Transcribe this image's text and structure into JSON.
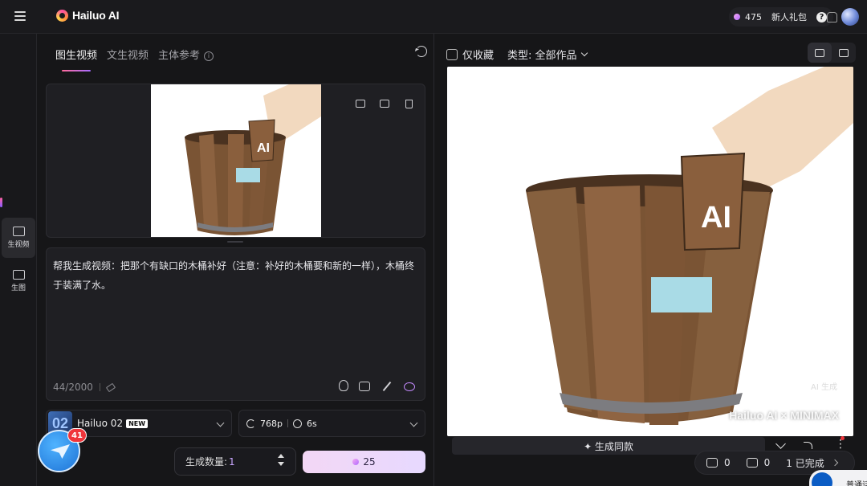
{
  "header": {
    "logo_text": "Hailuo AI",
    "credits": "475",
    "gift_label": "新人礼包",
    "help_label": "?"
  },
  "rail": {
    "items": [
      {
        "label": "生视频",
        "active": true
      },
      {
        "label": "生图",
        "active": false
      }
    ]
  },
  "left": {
    "tabs": [
      {
        "label": "图生视频",
        "active": true
      },
      {
        "label": "文生视频",
        "active": false
      },
      {
        "label": "主体参考",
        "active": false
      }
    ],
    "prompt": "帮我生成视频：把那个有缺口的木桶补好（注意：补好的木桶要和新的一样），木桶终于装满了水。",
    "char_count": "44/2000",
    "model": {
      "logo": "02",
      "name": "Hailuo 02",
      "badge": "NEW"
    },
    "resolution": "768p",
    "duration": "6s",
    "quantity_label": "生成数量:",
    "quantity_value": "1",
    "generate_cost": "25"
  },
  "right": {
    "favorites_label": "仅收藏",
    "type_filter": "类型: 全部作品",
    "ai_generated_mark": "AI 生成",
    "watermark": "Hailuo AI × MINIMAX",
    "same_style_label": "✦ 生成同款",
    "stats": {
      "likes": "0",
      "remixes": "0",
      "completed": "1 已完成"
    }
  },
  "notification_count": "41",
  "corner_chip_text": "普通话",
  "image_text": "AI",
  "colors": {
    "accent_pink": "#ff6b9a",
    "accent_purple": "#a66bff",
    "badge_red": "#f0353b"
  }
}
